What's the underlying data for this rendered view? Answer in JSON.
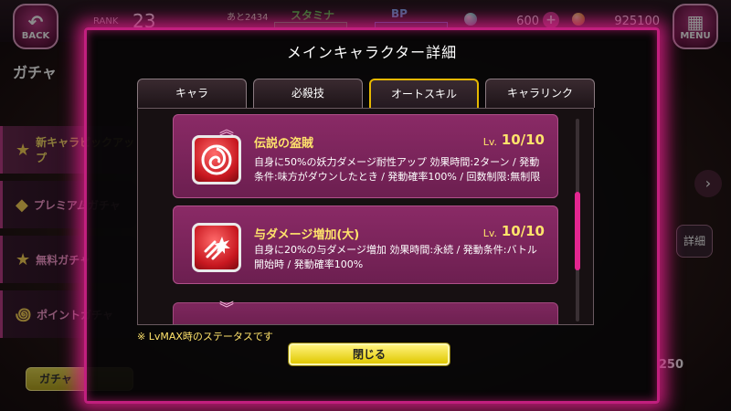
{
  "topbar": {
    "back_label": "BACK",
    "menu_label": "MENU",
    "rank_label": "RANK",
    "rank_value": "23",
    "stamina_next": "あと2434",
    "stamina_label": "スタミナ",
    "bp_label": "BP",
    "gems": "600",
    "gem_plus": "+",
    "coins": "925100"
  },
  "background": {
    "gacha_title": "ガチャ",
    "side_menu": [
      {
        "label": "新キャラピックアップ",
        "icon": "star-icon"
      },
      {
        "label": "プレミアムガチャ",
        "icon": "gem-icon"
      },
      {
        "label": "無料ガチャ",
        "icon": "star-icon"
      },
      {
        "label": "ポイントガチャ",
        "icon": "spiral-icon"
      }
    ],
    "detail_label": "詳細",
    "gacha_button": "ガチャ",
    "bottom_right_count": "250"
  },
  "modal": {
    "title": "メインキャラクター詳細",
    "tabs": [
      {
        "label": "キャラ",
        "active": false
      },
      {
        "label": "必殺技",
        "active": false
      },
      {
        "label": "オートスキル",
        "active": true
      },
      {
        "label": "キャラリンク",
        "active": false
      }
    ],
    "skills": [
      {
        "name": "伝説の盗賊",
        "lv_label": "Lv.",
        "lv": "10/10",
        "icon": "rose-icon",
        "description": "自身に50%の妖力ダメージ耐性アップ 効果時間:2ターン / 発動条件:味方がダウンしたとき / 発動確率100% / 回数制限:無制限"
      },
      {
        "name": "与ダメージ増加(大)",
        "lv_label": "Lv.",
        "lv": "10/10",
        "icon": "burst-icon",
        "description": "自身に20%の与ダメージ増加 効果時間:永続 / 発動条件:バトル開始時 / 発動確率100%"
      }
    ],
    "note": "※ LvMAX時のステータスです",
    "close_label": "閉じる",
    "accent_color": "#c11f7e",
    "highlight_color": "#ffe36b"
  }
}
